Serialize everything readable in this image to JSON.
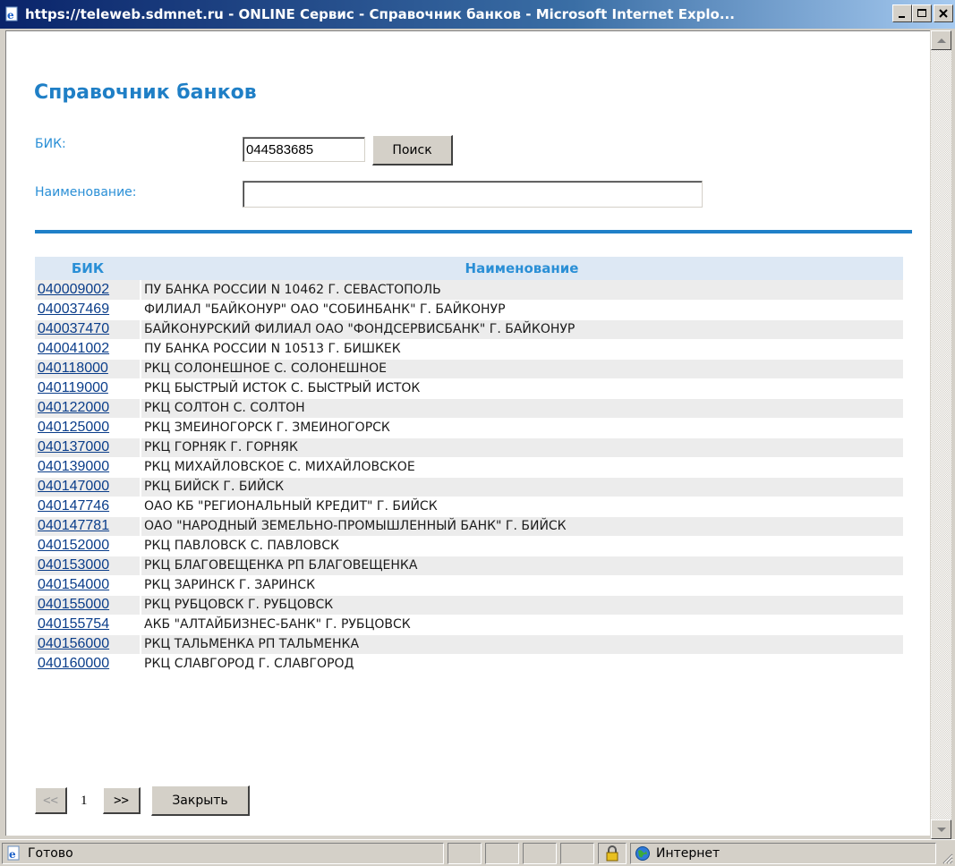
{
  "window": {
    "title": "https://teleweb.sdmnet.ru - ONLINE Сервис - Справочник банков - Microsoft Internet Explo...",
    "minimize_icon": "minimize-icon",
    "maximize_icon": "maximize-icon",
    "close_icon": "close-icon"
  },
  "page": {
    "title": "Справочник банков",
    "bik_label": "БИК:",
    "bik_value": "044583685",
    "search_button": "Поиск",
    "name_label": "Наименование:",
    "name_value": ""
  },
  "table": {
    "headers": {
      "bik": "БИК",
      "name": "Наименование"
    },
    "rows": [
      {
        "bik": "040009002",
        "name": "ПУ БАНКА РОССИИ N 10462 Г. СЕВАСТОПОЛЬ"
      },
      {
        "bik": "040037469",
        "name": "ФИЛИАЛ \"БАЙКОНУР\" ОАО \"СОБИНБАНК\" Г. БАЙКОНУР"
      },
      {
        "bik": "040037470",
        "name": "БАЙКОНУРСКИЙ ФИЛИАЛ ОАО \"ФОНДСЕРВИСБАНК\" Г. БАЙКОНУР"
      },
      {
        "bik": "040041002",
        "name": "ПУ БАНКА РОССИИ N 10513 Г. БИШКЕК"
      },
      {
        "bik": "040118000",
        "name": "РКЦ СОЛОНЕШНОЕ С. СОЛОНЕШНОЕ"
      },
      {
        "bik": "040119000",
        "name": "РКЦ БЫСТРЫЙ ИСТОК С. БЫСТРЫЙ ИСТОК"
      },
      {
        "bik": "040122000",
        "name": "РКЦ СОЛТОН С. СОЛТОН"
      },
      {
        "bik": "040125000",
        "name": "РКЦ ЗМЕИНОГОРСК Г. ЗМЕИНОГОРСК"
      },
      {
        "bik": "040137000",
        "name": "РКЦ ГОРНЯК Г. ГОРНЯК"
      },
      {
        "bik": "040139000",
        "name": "РКЦ МИХАЙЛОВСКОЕ С. МИХАЙЛОВСКОЕ"
      },
      {
        "bik": "040147000",
        "name": "РКЦ БИЙСК Г. БИЙСК"
      },
      {
        "bik": "040147746",
        "name": "ОАО КБ \"РЕГИОНАЛЬНЫЙ КРЕДИТ\" Г. БИЙСК"
      },
      {
        "bik": "040147781",
        "name": "ОАО \"НАРОДНЫЙ ЗЕМЕЛЬНО-ПРОМЫШЛЕННЫЙ БАНК\" Г. БИЙСК"
      },
      {
        "bik": "040152000",
        "name": "РКЦ ПАВЛОВСК С. ПАВЛОВСК"
      },
      {
        "bik": "040153000",
        "name": "РКЦ БЛАГОВЕЩЕНКА РП БЛАГОВЕЩЕНКА"
      },
      {
        "bik": "040154000",
        "name": "РКЦ ЗАРИНСК Г. ЗАРИНСК"
      },
      {
        "bik": "040155000",
        "name": "РКЦ РУБЦОВСК Г. РУБЦОВСК"
      },
      {
        "bik": "040155754",
        "name": "АКБ \"АЛТАЙБИЗНЕС-БАНК\" Г. РУБЦОВСК"
      },
      {
        "bik": "040156000",
        "name": "РКЦ ТАЛЬМЕНКА РП ТАЛЬМЕНКА"
      },
      {
        "bik": "040160000",
        "name": "РКЦ СЛАВГОРОД Г. СЛАВГОРОД"
      }
    ]
  },
  "pager": {
    "prev_label": "<<",
    "current_page": "1",
    "next_label": ">>",
    "close_button": "Закрыть"
  },
  "statusbar": {
    "status_text": "Готово",
    "zone_text": "Интернет",
    "page_icon": "ie-page-icon",
    "lock_icon": "lock-icon",
    "zone_icon": "globe-icon"
  },
  "colors": {
    "title_blue": "#1f7fc6",
    "label_blue": "#2a8fd6",
    "divider": "#1f80c8",
    "header_bg": "#dde8f4",
    "row_alt": "#ececec",
    "link": "#0a3d8a"
  }
}
